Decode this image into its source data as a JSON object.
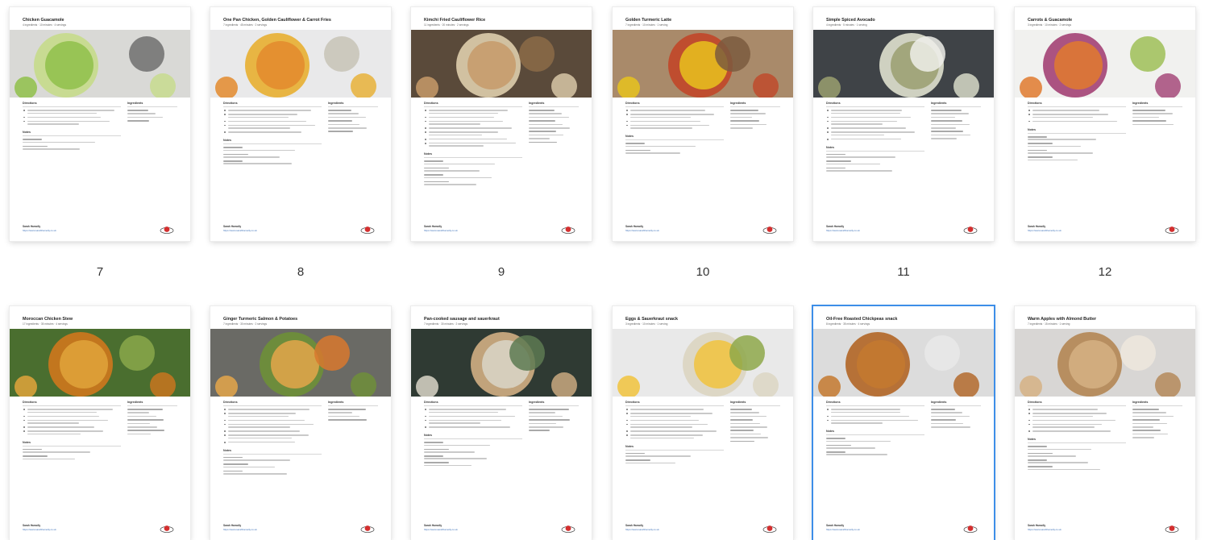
{
  "footer": {
    "author": "Sarah Hamolly",
    "url": "https://www.sarahhamolly.co.uk"
  },
  "labels": {
    "directions": "Directions",
    "ingredients": "Ingredients",
    "notes": "Notes"
  },
  "pages": [
    {
      "number": "7",
      "title": "Chicken Guacamole",
      "meta": "4 ingredients · 10 minutes · 4 servings",
      "palette": [
        "#d9d9d6",
        "#8fbf4a",
        "#c7db8e",
        "#6e6e6e"
      ],
      "selected": false
    },
    {
      "number": "8",
      "title": "One Pan Chicken, Golden Cauliflower & Carrot Fries",
      "meta": "7 ingredients · 45 minutes · 2 servings",
      "palette": [
        "#e9e9ea",
        "#e38a2d",
        "#e8b23a",
        "#c7c3b6"
      ],
      "selected": false
    },
    {
      "number": "9",
      "title": "Kimchi Fried Cauliflower Rice",
      "meta": "11 ingredients · 20 minutes · 2 servings",
      "palette": [
        "#5a4a3a",
        "#c79a6a",
        "#d8c7a7",
        "#8c6b48"
      ],
      "selected": false
    },
    {
      "number": "10",
      "title": "Golden Turmeric Latte",
      "meta": "7 ingredients · 10 minutes · 1 serving",
      "palette": [
        "#a98a6a",
        "#e8c21d",
        "#c04a2c",
        "#7b5a3e"
      ],
      "selected": false
    },
    {
      "number": "11",
      "title": "Simple Spiced Avocado",
      "meta": "4 ingredients · 5 minutes · 1 serving",
      "palette": [
        "#3f4347",
        "#9a9f70",
        "#d7d9c8",
        "#eeeeea"
      ],
      "selected": false
    },
    {
      "number": "12",
      "title": "Carrots & Guacamole",
      "meta": "3 ingredients · 10 minutes · 2 servings",
      "palette": [
        "#f1f1ef",
        "#e07a2e",
        "#a64a7a",
        "#9fbf57"
      ],
      "selected": false
    },
    {
      "number": "",
      "title": "Moroccan Chicken Stew",
      "meta": "17 ingredients · 35 minutes · 4 servings",
      "palette": [
        "#4a6e2f",
        "#e0a43b",
        "#c8761e",
        "#8aa84a"
      ],
      "selected": false
    },
    {
      "number": "",
      "title": "Ginger Turmeric Salmon & Potatoes",
      "meta": "7 ingredients · 30 minutes · 2 servings",
      "palette": [
        "#6a6a65",
        "#e4a64a",
        "#6e8e3a",
        "#d8782e"
      ],
      "selected": false
    },
    {
      "number": "",
      "title": "Pan-cooked sausage and sauerkraut",
      "meta": "7 ingredients · 30 minutes · 2 servings",
      "palette": [
        "#2f3a33",
        "#d9d6c8",
        "#c9a980",
        "#5d7a52"
      ],
      "selected": false
    },
    {
      "number": "",
      "title": "Eggs & Sauerkraut snack",
      "meta": "3 ingredients · 10 minutes · 1 serving",
      "palette": [
        "#e9e9e9",
        "#f1c33d",
        "#dcd6c3",
        "#8ea84a"
      ],
      "selected": false
    },
    {
      "number": "",
      "title": "Oil-Free Roasted Chickpeas snack",
      "meta": "8 ingredients · 35 minutes · 4 servings",
      "palette": [
        "#dcdcdc",
        "#c4792f",
        "#b36a2d",
        "#e9e9e9"
      ],
      "selected": true
    },
    {
      "number": "",
      "title": "Warm Apples with Almond Butter",
      "meta": "7 ingredients · 15 minutes · 1 serving",
      "palette": [
        "#d8d6d4",
        "#d6b184",
        "#b58a5a",
        "#efe8dd"
      ],
      "selected": false
    }
  ]
}
